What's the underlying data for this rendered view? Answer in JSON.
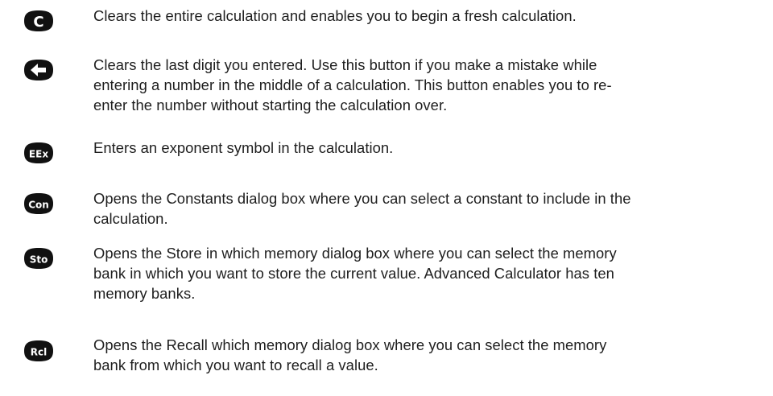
{
  "entries": [
    {
      "icon": "clear-all-icon",
      "icon_label": "C",
      "lines": [
        "Clears the entire calculation and enables you to begin a fresh calculation."
      ]
    },
    {
      "icon": "backspace-arrow-icon",
      "icon_label": "",
      "lines": [
        "Clears the last digit you entered. Use this button if you make a mistake while",
        "entering a number in the middle of a calculation. This button enables you to re-",
        "enter the number without starting the calculation over."
      ]
    },
    {
      "icon": "exponent-icon",
      "icon_label": "EEx",
      "lines": [
        "Enters an exponent symbol in the calculation."
      ]
    },
    {
      "icon": "constants-icon",
      "icon_label": "Con",
      "lines": [
        "Opens the Constants dialog box where you can select a constant to include in the",
        "calculation."
      ]
    },
    {
      "icon": "store-icon",
      "icon_label": "Sto",
      "lines": [
        "Opens the Store in which memory dialog box where you can select the memory",
        "bank in which you want to store the current value. Advanced Calculator has ten",
        "memory banks."
      ]
    },
    {
      "icon": "recall-icon",
      "icon_label": "Rcl",
      "lines": [
        "Opens the Recall which memory dialog box where you can select the memory",
        "bank from which you want to recall a value."
      ]
    }
  ],
  "colors": {
    "icon_fill": "#111111",
    "icon_text": "#ffffff",
    "body_text": "#1e1e1e"
  }
}
